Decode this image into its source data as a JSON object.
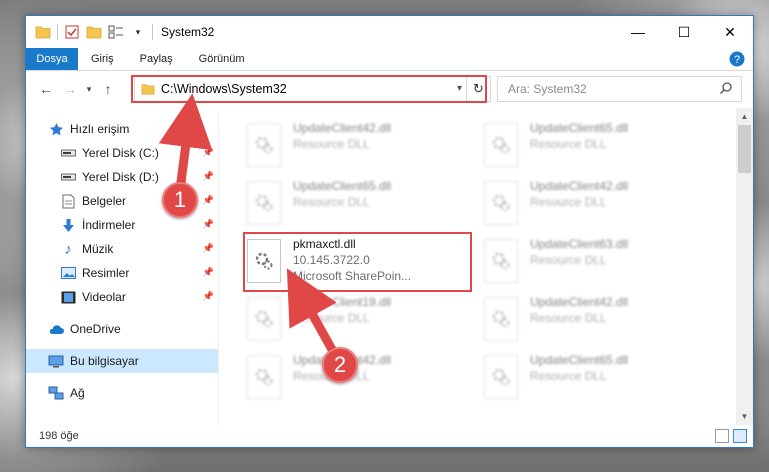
{
  "window": {
    "title": "System32",
    "controls": {
      "minimize": "—",
      "maximize": "☐",
      "close": "✕"
    }
  },
  "ribbon": {
    "tabs": [
      {
        "label": "Dosya"
      },
      {
        "label": "Giriş"
      },
      {
        "label": "Paylaş"
      },
      {
        "label": "Görünüm"
      }
    ]
  },
  "navbar": {
    "address": "C:\\Windows\\System32",
    "search_placeholder": "Ara: System32"
  },
  "sidebar": {
    "items": [
      {
        "label": "Hızlı erişim",
        "icon": "star-icon"
      },
      {
        "label": "Yerel Disk (C:)",
        "icon": "drive-icon",
        "pinned": true
      },
      {
        "label": "Yerel Disk (D:)",
        "icon": "drive-icon",
        "pinned": true
      },
      {
        "label": "Belgeler",
        "icon": "documents-icon",
        "pinned": true
      },
      {
        "label": "İndirmeler",
        "icon": "download-icon",
        "pinned": true
      },
      {
        "label": "Müzik",
        "icon": "music-icon",
        "pinned": true
      },
      {
        "label": "Resimler",
        "icon": "pictures-icon",
        "pinned": true
      },
      {
        "label": "Videolar",
        "icon": "video-icon",
        "pinned": true
      },
      {
        "label": "OneDrive",
        "icon": "cloud-icon"
      },
      {
        "label": "Bu bilgisayar",
        "icon": "computer-icon",
        "selected": true
      },
      {
        "label": "Ağ",
        "icon": "network-icon"
      }
    ]
  },
  "files": {
    "left": [
      {
        "name": "UpdateClient42.dll",
        "sub": "Resource DLL"
      },
      {
        "name": "UpdateClient65.dll",
        "sub": "Resource DLL"
      },
      {
        "name": "pkmaxctl.dll",
        "version": "10.145.3722.0",
        "sub": "Microsoft SharePoin..."
      },
      {
        "name": "UpdateClient19.dll",
        "sub": "Resource DLL"
      },
      {
        "name": "UpdateClient42.dll",
        "sub": "Resource DLL"
      }
    ],
    "right": [
      {
        "name": "UpdateClient65.dll",
        "sub": "Resource DLL"
      },
      {
        "name": "UpdateClient42.dll",
        "sub": "Resource DLL"
      },
      {
        "name": "UpdateClient63.dll",
        "sub": "Resource DLL"
      },
      {
        "name": "UpdateClient42.dll",
        "sub": "Resource DLL"
      },
      {
        "name": "UpdateClient65.dll",
        "sub": "Resource DLL"
      }
    ]
  },
  "status": {
    "count": "198 öğe"
  },
  "annotations": {
    "step1": "1",
    "step2": "2",
    "color": "#e04848"
  }
}
